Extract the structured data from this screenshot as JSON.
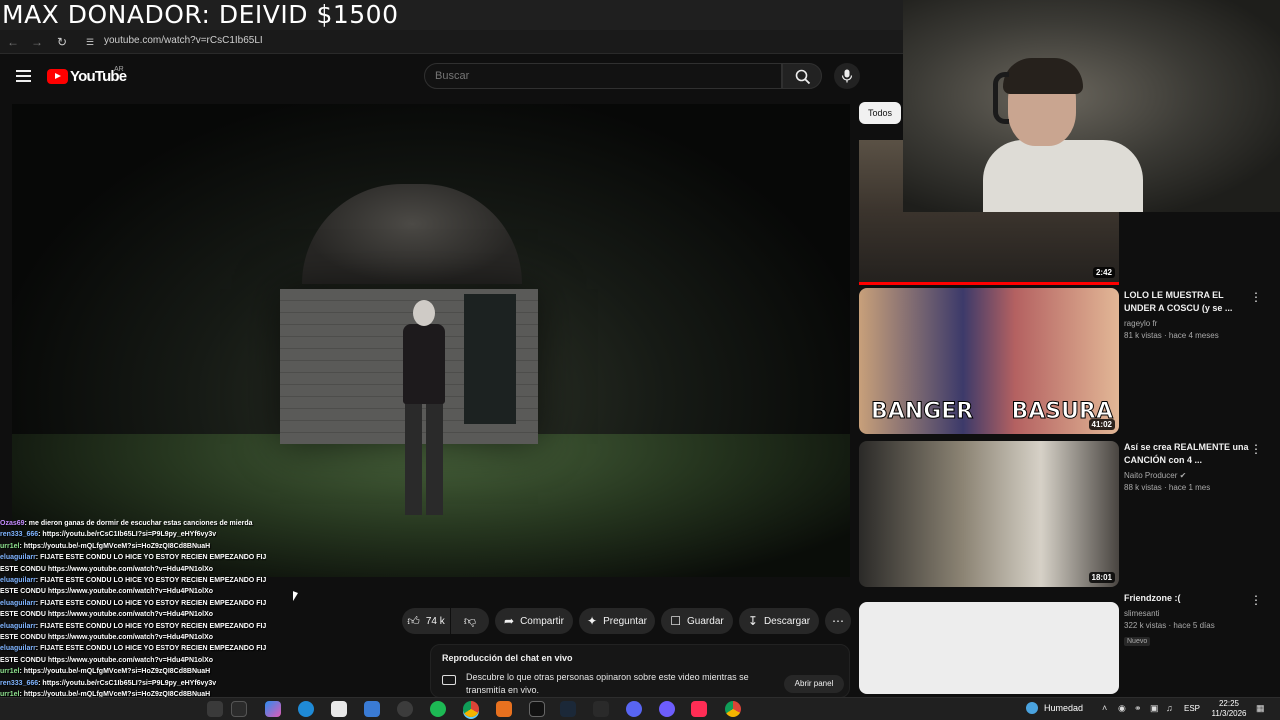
{
  "overlay_title": "MAX DONADOR: DEIVID $1500",
  "browser": {
    "url": "youtube.com/watch?v=rCsC1Ib65LI"
  },
  "youtube": {
    "logo_text": "YouTube",
    "country_code": "AR",
    "search_placeholder": "Buscar"
  },
  "chat_lines": [
    {
      "user": "Ozas69",
      "text": ": me dieron ganas de dormir de escuchar estas canciones de mierda",
      "color": "purple"
    },
    {
      "user": "ren333_666",
      "text": ": https://youtu.be/rCsC1Ib65LI?si=P9L9py_eHYf6vy3v",
      "color": "blue"
    },
    {
      "user": "urr1el",
      "text": ": https://youtu.be/-mQLfgMVceM?si=HoZ9zQI8Cd8BNuaH",
      "color": "green"
    },
    {
      "user": "eluaguilarr",
      "text": ": FIJATE ESTE CONDU LO HICE YO ESTOY RECIEN EMPEZANDO FIJATE",
      "color": "blue"
    },
    {
      "user": "",
      "text": "ESTE CONDU https://www.youtube.com/watch?v=Hdu4PN1olXo",
      "color": "blue"
    },
    {
      "user": "eluaguilarr",
      "text": ": FIJATE ESTE CONDU LO HICE YO ESTOY RECIEN EMPEZANDO FIJATE",
      "color": "blue"
    },
    {
      "user": "",
      "text": "ESTE CONDU https://www.youtube.com/watch?v=Hdu4PN1olXo",
      "color": "blue"
    },
    {
      "user": "eluaguilarr",
      "text": ": FIJATE ESTE CONDU LO HICE YO ESTOY RECIEN EMPEZANDO FIJATE",
      "color": "blue"
    },
    {
      "user": "",
      "text": "ESTE CONDU https://www.youtube.com/watch?v=Hdu4PN1olXo",
      "color": "blue"
    },
    {
      "user": "eluaguilarr",
      "text": ": FIJATE ESTE CONDU LO HICE YO ESTOY RECIEN EMPEZANDO FIJATE",
      "color": "blue"
    },
    {
      "user": "",
      "text": "ESTE CONDU https://www.youtube.com/watch?v=Hdu4PN1olXo",
      "color": "blue"
    },
    {
      "user": "eluaguilarr",
      "text": ": FIJATE ESTE CONDU LO HICE YO ESTOY RECIEN EMPEZANDO FIJATE",
      "color": "blue"
    },
    {
      "user": "",
      "text": "ESTE CONDU https://www.youtube.com/watch?v=Hdu4PN1olXo",
      "color": "blue"
    },
    {
      "user": "urr1el",
      "text": ": https://youtu.be/-mQLfgMVceM?si=HoZ9zQI8Cd8BNuaH",
      "color": "green"
    },
    {
      "user": "ren333_666",
      "text": ": https://youtu.be/rCsC1Ib65LI?si=P9L9py_eHYf6vy3v",
      "color": "blue"
    },
    {
      "user": "urr1el",
      "text": ": https://youtu.be/-mQLfgMVceM?si=HoZ9zQI8Cd8BNuaH",
      "color": "green"
    }
  ],
  "actions": {
    "likes": "74 k",
    "share": "Compartir",
    "ask": "Preguntar",
    "save": "Guardar",
    "download": "Descargar"
  },
  "live_chat": {
    "title": "Reproducción del chat en vivo",
    "description": "Descubre lo que otras personas opinaron sobre este video mientras se transmitía en vivo.",
    "open_button": "Abrir panel"
  },
  "sidebar": {
    "chip": "Todos",
    "videos": [
      {
        "duration": "2:42",
        "title": "",
        "channel": "",
        "views": ""
      },
      {
        "duration": "41:02",
        "title": "LOLO LE MUESTRA EL UNDER A COSCU (y se ...",
        "channel": "rageylo fr",
        "views": "81 k vistas · hace 4 meses",
        "thumb_words": [
          "BANGER",
          "BASURA"
        ]
      },
      {
        "duration": "18:01",
        "title": "Así se crea REALMENTE una CANCIÓN con 4 ...",
        "channel": "Naito Producer",
        "views": "88 k vistas · hace 1 mes"
      },
      {
        "duration": "",
        "title": "Friendzone :(",
        "channel": "slimesanti",
        "views": "322 k vistas · hace 5 días",
        "badge": "Nuevo"
      }
    ]
  },
  "taskbar": {
    "weather": "Humedad",
    "lang": "ESP",
    "time": "22:25",
    "date": "11/3/2026"
  },
  "colors": {
    "youtube_red": "#ff0000",
    "background": "#0f0f0f",
    "pill": "#272727"
  }
}
